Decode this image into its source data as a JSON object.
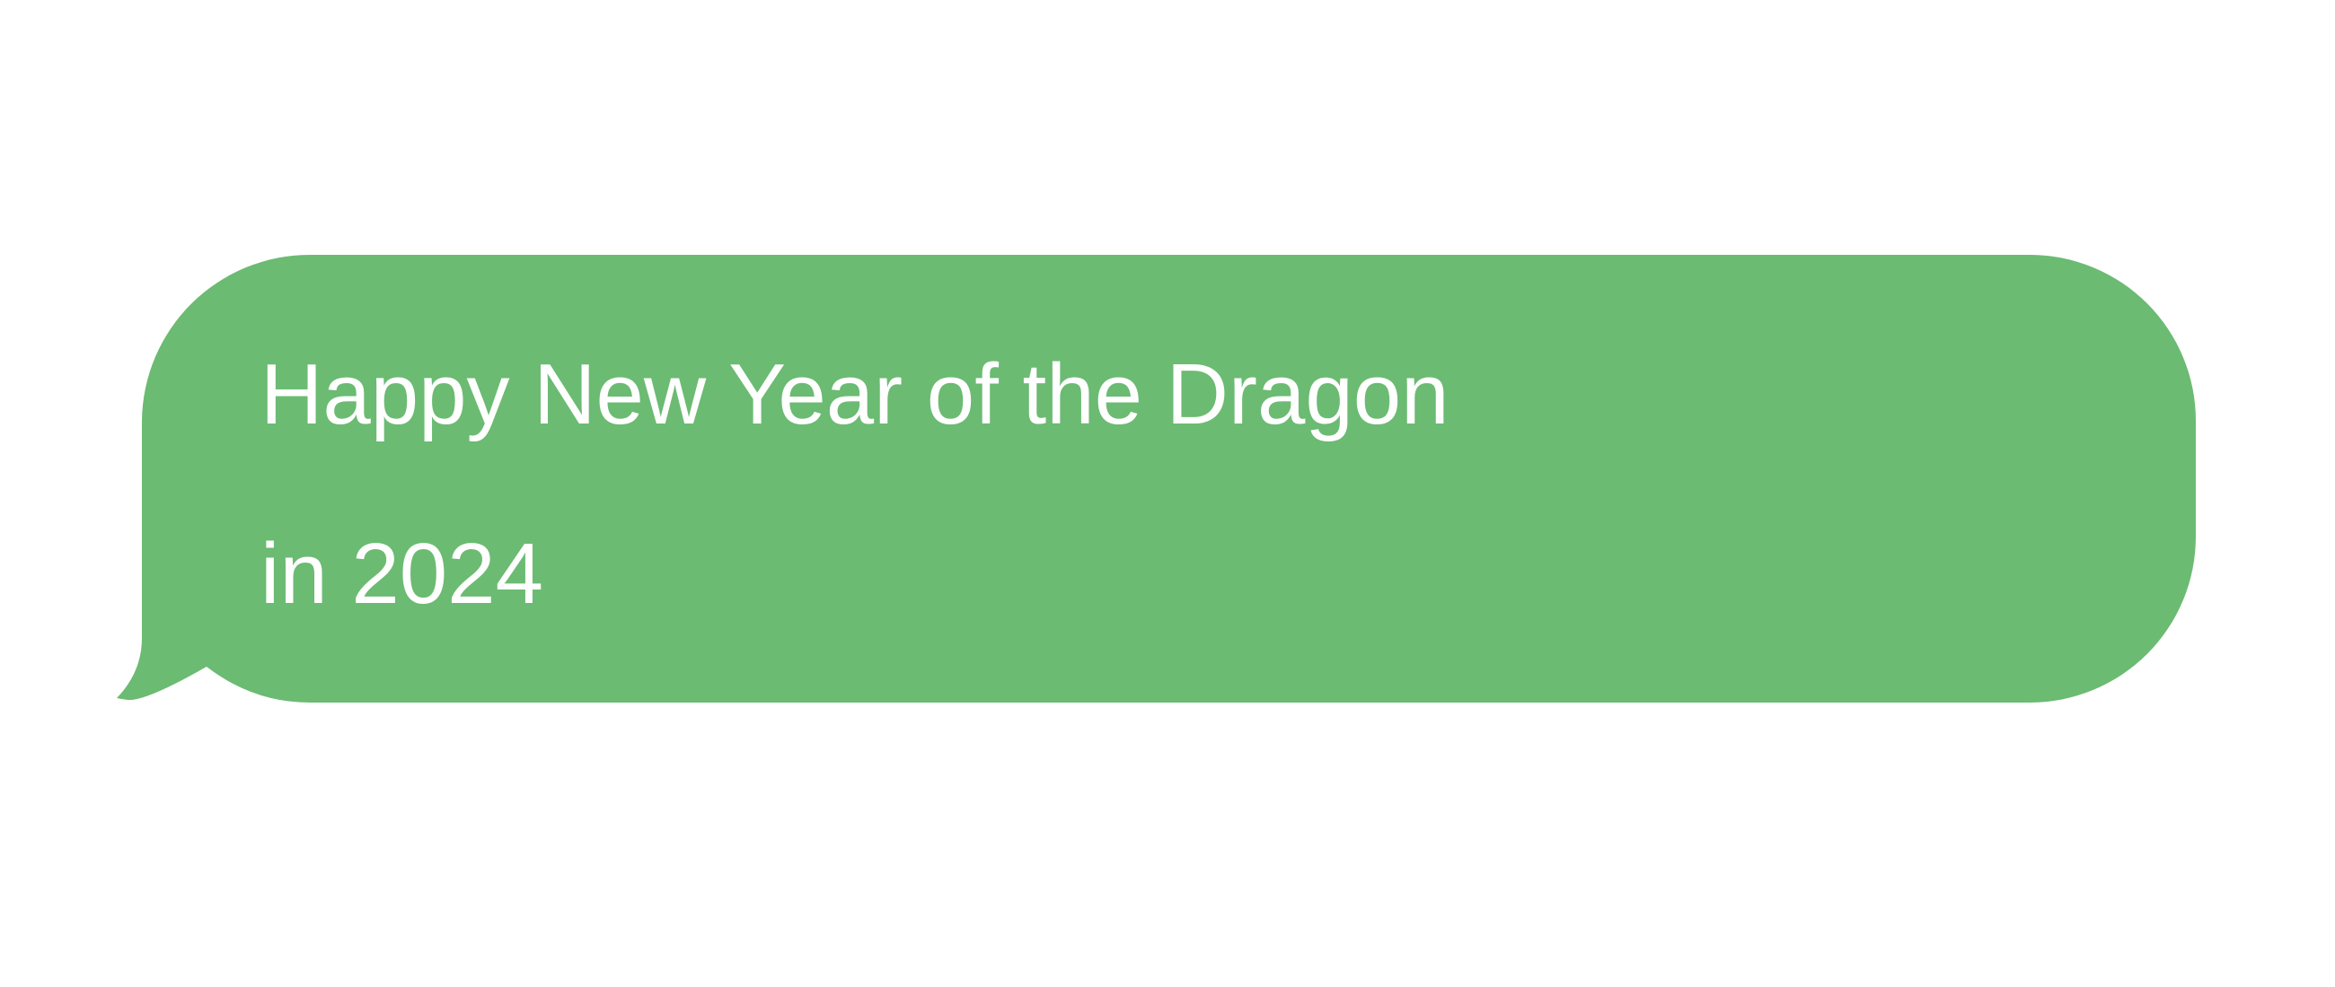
{
  "message": {
    "line1": "Happy New Year of the Dragon",
    "line2": "in 2024"
  },
  "colors": {
    "bubble": "#6bbb72",
    "text": "#ffffff",
    "background": "#ffffff"
  }
}
